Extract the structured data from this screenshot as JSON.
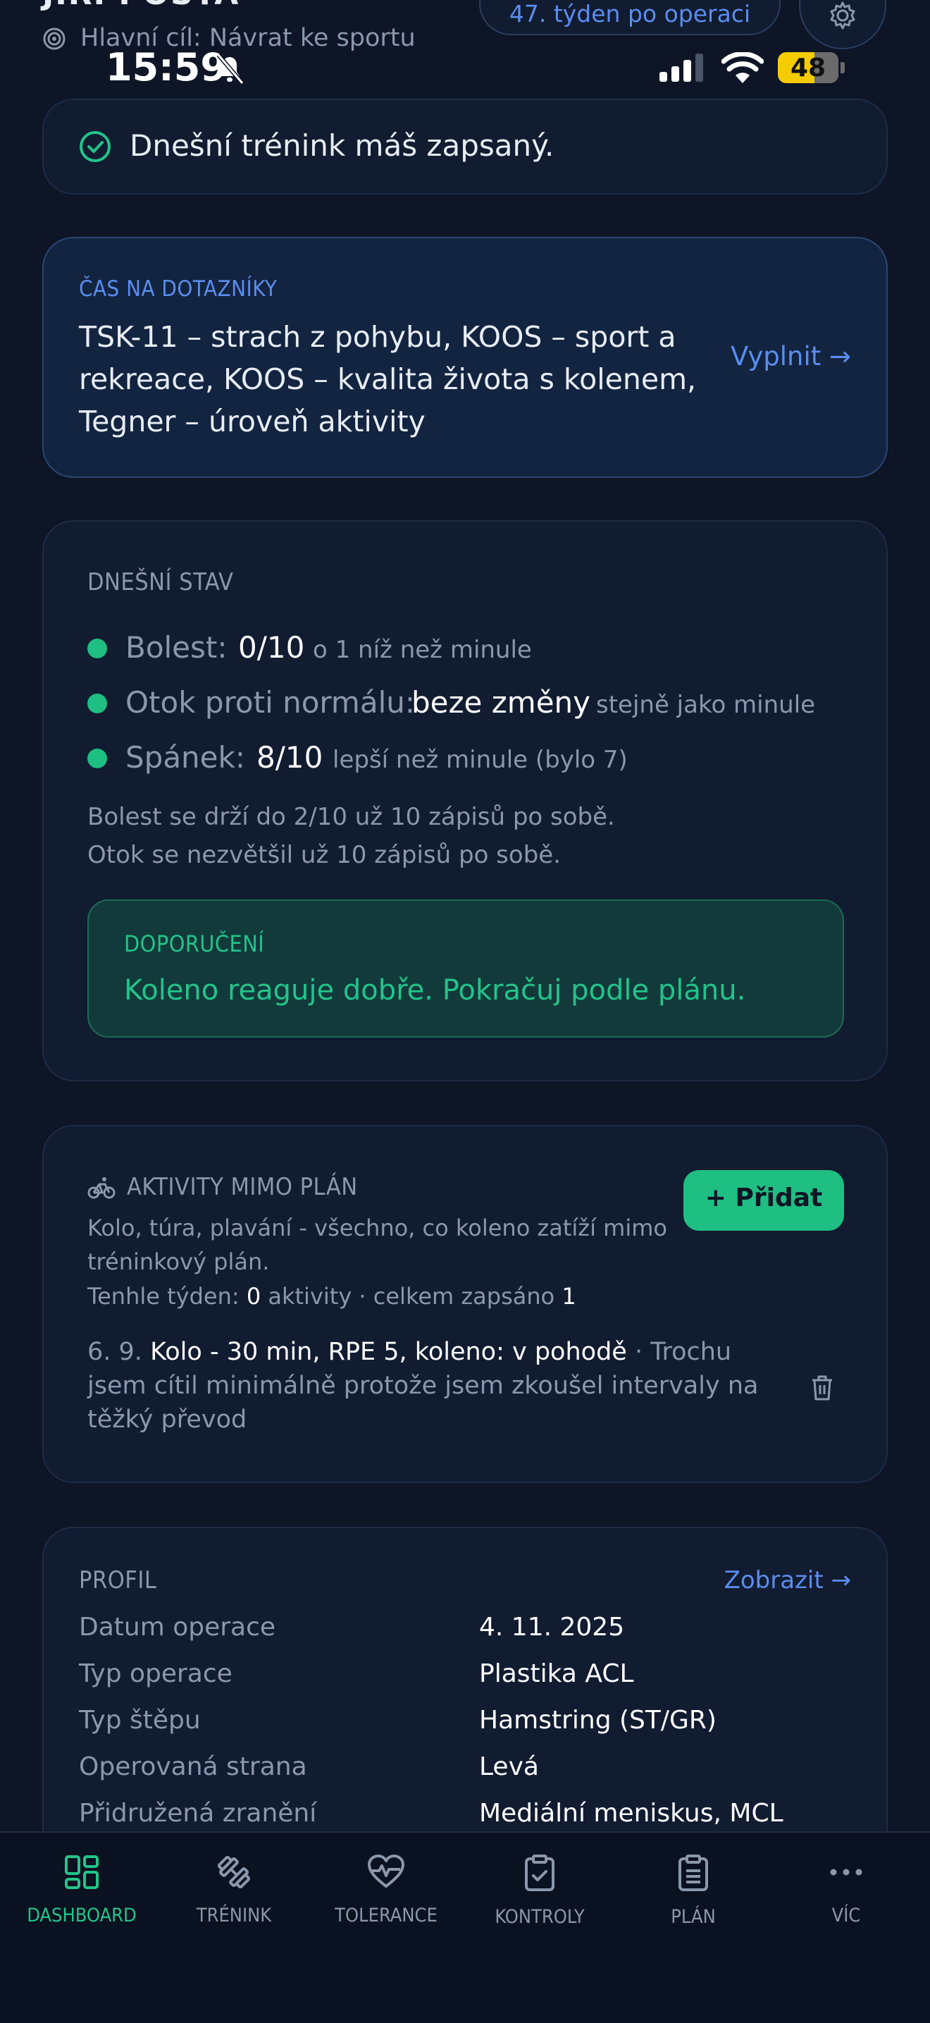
{
  "header": {
    "name_partial": "JIRI POSTA",
    "goal": "Hlavní cíl: Návrat ke sportu",
    "week_badge": "47. týden po operaci"
  },
  "status_bar": {
    "time": "15:59",
    "battery": "48"
  },
  "notice": {
    "text": "Dnešní trénink máš zapsaný."
  },
  "questionnaire": {
    "title": "ČAS NA DOTAZNÍKY",
    "lines": [
      "TSK-11 – strach z pohybu, KOOS – sport a",
      "rekreace, KOOS – kvalita života s kolenem,",
      "Tegner – úroveň aktivity"
    ],
    "action": "Vyplnit →"
  },
  "today": {
    "title": "DNEŠNÍ STAV",
    "metrics": [
      {
        "label": "Bolest:",
        "value": "0/10",
        "note": "o 1 níž než minule"
      },
      {
        "label": "Otok proti normálu:",
        "value": "beze změny",
        "note": "stejně jako minule"
      },
      {
        "label": "Spánek:",
        "value": "8/10",
        "note": "lepší než minule (bylo 7)"
      }
    ],
    "summary": [
      "Bolest se drží do 2/10 už 10 zápisů po sobě.",
      "Otok se nezvětšil už 10 zápisů po sobě."
    ],
    "recommendation": {
      "title": "DOPORUČENÍ",
      "text": "Koleno reaguje dobře. Pokračuj podle plánu."
    },
    "status_color": "#1fbe82"
  },
  "activities": {
    "title": "AKTIVITY MIMO PLÁN",
    "description": [
      "Kolo, túra, plavání - všechno, co koleno zatíží mimo",
      "tréninkový plán."
    ],
    "stats": {
      "prefix": "Tenhle týden:",
      "week_count": "0",
      "mid": "aktivity · celkem zapsáno",
      "total": "1"
    },
    "add_button": "+ Přidat",
    "entry": {
      "date": "6. 9.",
      "main": "Kolo - 30 min, RPE 5, koleno: v pohodě",
      "note_line1": "· Trochu",
      "note_line2": "jsem cítil minimálně protože jsem zkoušel intervaly na",
      "note_line3": "těžký převod"
    }
  },
  "profile": {
    "title": "PROFIL",
    "action": "Zobrazit →",
    "rows": [
      {
        "key": "Datum operace",
        "value": "4. 11. 2025"
      },
      {
        "key": "Typ operace",
        "value": "Plastika ACL"
      },
      {
        "key": "Typ štěpu",
        "value": "Hamstring (ST/GR)"
      },
      {
        "key": "Operovaná strana",
        "value": "Levá"
      },
      {
        "key": "Přidružená zranění",
        "value": "Mediální meniskus, MCL"
      }
    ]
  },
  "nav": [
    {
      "label": "DASHBOARD",
      "icon": "dashboard-icon",
      "active": true
    },
    {
      "label": "TRÉNINK",
      "icon": "dumbbell-icon",
      "active": false
    },
    {
      "label": "TOLERANCE",
      "icon": "heart-pulse-icon",
      "active": false
    },
    {
      "label": "KONTROLY",
      "icon": "clipboard-check-icon",
      "active": false
    },
    {
      "label": "PLÁN",
      "icon": "clipboard-list-icon",
      "active": false
    },
    {
      "label": "VÍC",
      "icon": "more-icon",
      "active": false
    }
  ],
  "colors": {
    "accent_blue": "#5b8def",
    "accent_green": "#22c48a",
    "background": "#0d1526"
  }
}
